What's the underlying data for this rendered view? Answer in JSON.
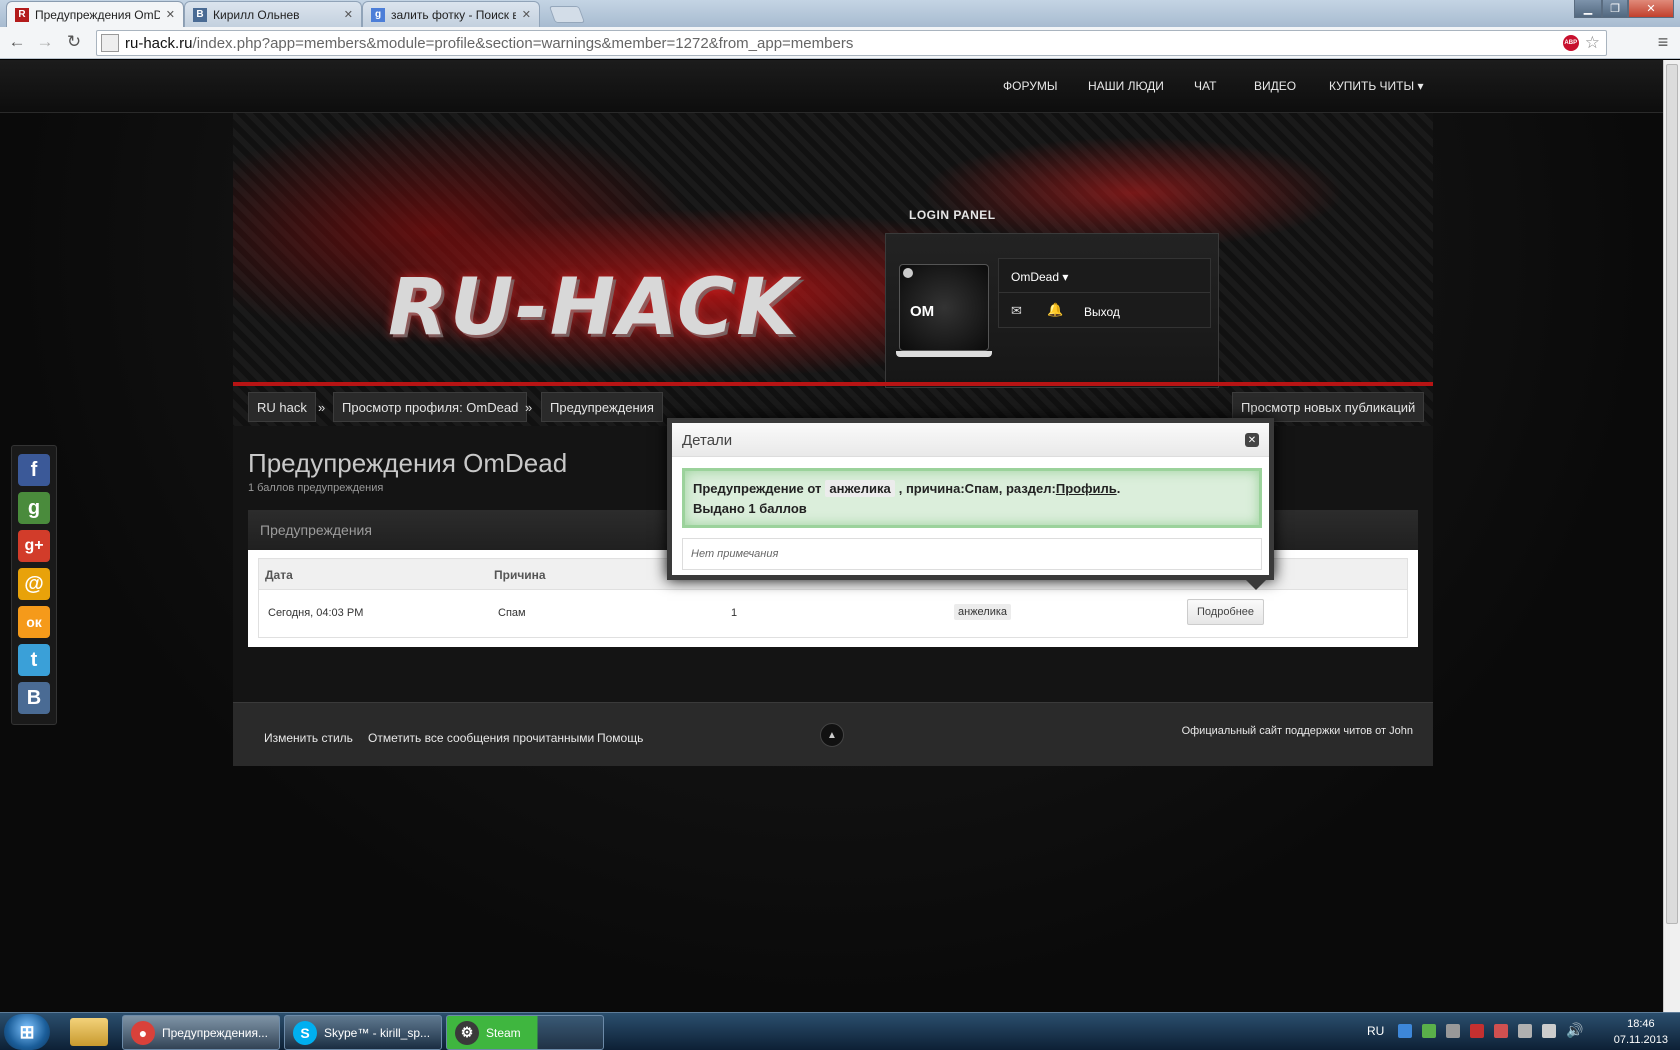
{
  "browser": {
    "tabs": [
      {
        "title": "Предупреждения OmDea",
        "favicon": "R",
        "favcolor": "#b31b1b",
        "active": true
      },
      {
        "title": "Кирилл Ольнев",
        "favicon": "В",
        "favcolor": "#4a6b94",
        "active": false
      },
      {
        "title": "залить фотку - Поиск в G",
        "favicon": "g",
        "favcolor": "#4c7ed8",
        "active": false
      }
    ],
    "url_host": "ru-hack.ru",
    "url_path": "/index.php?app=members&module=profile&section=warnings&member=1272&from_app=members",
    "abp_label": "ABP"
  },
  "site": {
    "nav": [
      "ФОРУМЫ",
      "НАШИ ЛЮДИ",
      "ЧАТ",
      "ВИДЕО",
      "КУПИТЬ ЧИТЫ"
    ],
    "logo": "RU-HACK",
    "login_panel_title": "LOGIN PANEL",
    "username": "OmDead",
    "logout": "Выход",
    "avatar_text": "OM"
  },
  "breadcrumbs": [
    "RU hack",
    "Просмотр профиля: OmDead",
    "Предупреждения"
  ],
  "breadcrumb_sep": "»",
  "new_posts": "Просмотр новых публикаций",
  "page": {
    "title": "Предупреждения OmDead",
    "subtitle": "1 баллов предупреждения",
    "section": "Предупреждения",
    "columns": [
      "Дата",
      "Причина"
    ],
    "row": {
      "date": "Сегодня, 04:03 PM",
      "reason": "Спам",
      "points": "1",
      "moderator": "анжелика",
      "details_button": "Подробнее"
    }
  },
  "modal": {
    "title": "Детали",
    "line1_prefix": "Предупреждение от",
    "line1_user": "анжелика",
    "line1_mid": ", причина:Спам, раздел:",
    "line1_link": "Профиль",
    "line1_end": ".",
    "line2": "Выдано 1 баллов",
    "note": "Нет примечания"
  },
  "footer": {
    "links": [
      "Изменить стиль",
      "Отметить все сообщения прочитанными",
      "Помощь"
    ],
    "copyright": "Официальный сайт поддержки читов от John"
  },
  "social": [
    {
      "name": "facebook-icon",
      "glyph": "f",
      "color": "#3b5998"
    },
    {
      "name": "google-icon",
      "glyph": "g",
      "color": "#4a8b3c"
    },
    {
      "name": "google-plus-icon",
      "glyph": "g+",
      "color": "#d23c2a"
    },
    {
      "name": "mailru-icon",
      "glyph": "@",
      "color": "#e8a20a"
    },
    {
      "name": "odnoklassniki-icon",
      "glyph": "ок",
      "color": "#f59a1a"
    },
    {
      "name": "twitter-icon",
      "glyph": "t",
      "color": "#3aa0d8"
    },
    {
      "name": "vkontakte-icon",
      "glyph": "B",
      "color": "#4a6b94"
    }
  ],
  "taskbar": {
    "items": [
      {
        "title": "Предупреждения...",
        "icon": "chrome-icon",
        "color": "#d9413a"
      },
      {
        "title": "Skype™ - kirill_sp...",
        "icon": "skype-icon",
        "color": "#00aff0"
      },
      {
        "title": "Steam",
        "icon": "steam-icon",
        "color": "#3a3a3a"
      }
    ],
    "lang": "RU",
    "time": "18:46",
    "date": "07.11.2013"
  }
}
